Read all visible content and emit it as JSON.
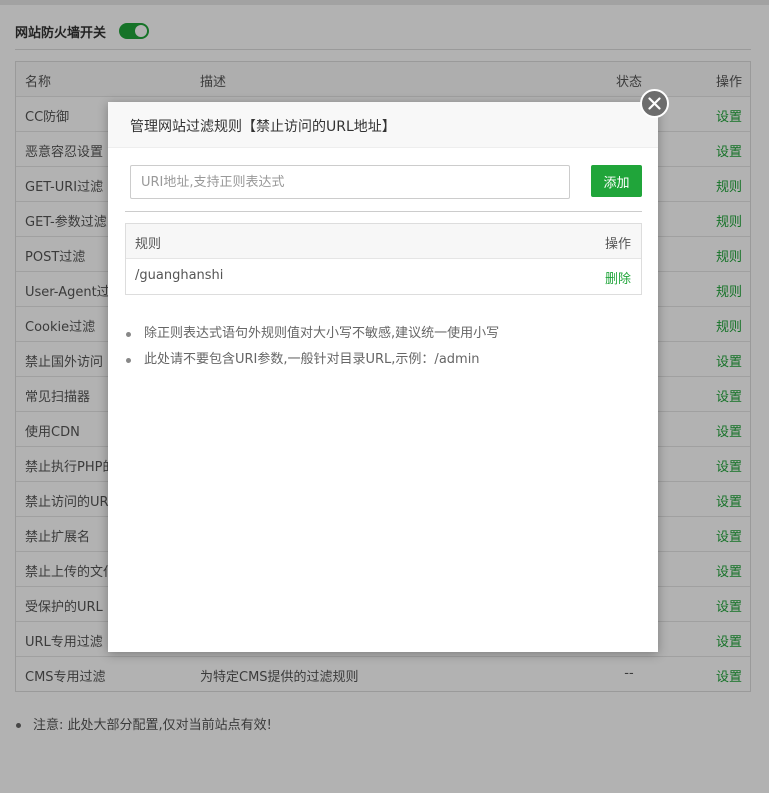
{
  "header": {
    "label": "网站防火墙开关",
    "switch_on": true
  },
  "rules_table": {
    "columns": {
      "name": "名称",
      "desc": "描述",
      "status": "状态",
      "action": "操作"
    },
    "rows": [
      {
        "name": "CC防御",
        "desc": "",
        "status": "",
        "action": "设置"
      },
      {
        "name": "恶意容忍设置",
        "desc": "",
        "status": "",
        "action": "设置"
      },
      {
        "name": "GET-URI过滤",
        "desc": "",
        "status": "",
        "action": "规则"
      },
      {
        "name": "GET-参数过滤",
        "desc": "",
        "status": "",
        "action": "规则"
      },
      {
        "name": "POST过滤",
        "desc": "",
        "status": "",
        "action": "规则"
      },
      {
        "name": "User-Agent过",
        "desc": "",
        "status": "",
        "action": "规则"
      },
      {
        "name": "Cookie过滤",
        "desc": "",
        "status": "",
        "action": "规则"
      },
      {
        "name": "禁止国外访问",
        "desc": "",
        "status": "",
        "action": "设置"
      },
      {
        "name": "常见扫描器",
        "desc": "",
        "status": "",
        "action": "设置"
      },
      {
        "name": "使用CDN",
        "desc": "",
        "status": "",
        "action": "设置"
      },
      {
        "name": "禁止执行PHP的",
        "desc": "",
        "status": "",
        "action": "设置"
      },
      {
        "name": "禁止访问的UR",
        "desc": "",
        "status": "",
        "action": "设置"
      },
      {
        "name": "禁止扩展名",
        "desc": "",
        "status": "",
        "action": "设置"
      },
      {
        "name": "禁止上传的文仆",
        "desc": "",
        "status": "",
        "action": "设置"
      },
      {
        "name": "受保护的URL",
        "desc": "",
        "status": "",
        "action": "设置"
      },
      {
        "name": "URL专用过滤",
        "desc": "",
        "status": "",
        "action": "设置"
      },
      {
        "name": "CMS专用过滤",
        "desc": "为特定CMS提供的过滤规则",
        "status": "--",
        "action": "设置"
      }
    ]
  },
  "note": "注意: 此处大部分配置,仅对当前站点有效!",
  "modal": {
    "title": "管理网站过滤规则【禁止访问的URL地址】",
    "input_placeholder": "URI地址,支持正则表达式",
    "input_value": "",
    "add_label": "添加",
    "columns": {
      "rule": "规则",
      "action": "操作"
    },
    "rows": [
      {
        "rule": "/guanghanshi",
        "action": "删除"
      }
    ],
    "tips": [
      "除正则表达式语句外规则值对大小写不敏感,建议统一使用小写",
      "此处请不要包含URI参数,一般针对目录URL,示例：/admin"
    ]
  },
  "colors": {
    "accent": "#20a53a",
    "overlay": "rgba(0,0,0,0.3)"
  }
}
